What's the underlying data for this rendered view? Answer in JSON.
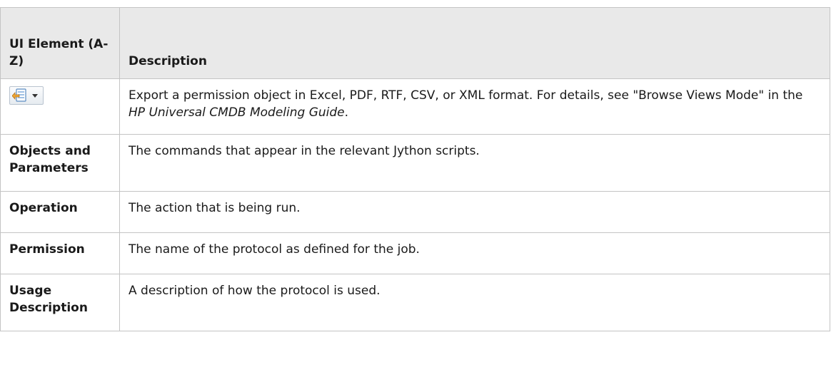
{
  "table": {
    "header": {
      "ui_element": "UI Element (A-Z)",
      "description": "Description"
    },
    "export_row": {
      "icon": "export-icon",
      "desc_part1": "Export a permission object in Excel, PDF, RTF, CSV, or XML format. For details, see \"Browse Views Mode\" in the ",
      "desc_italic": "HP Universal CMDB Modeling Guide",
      "desc_part2": "."
    },
    "rows": [
      {
        "element": "Objects and Parameters",
        "description": "The commands that appear in the relevant Jython scripts."
      },
      {
        "element": "Operation",
        "description": "The action that is being run."
      },
      {
        "element": "Permission",
        "description": "The name of the protocol as defined for the job."
      },
      {
        "element": "Usage Description",
        "description": "A description of how the protocol is used."
      }
    ]
  }
}
